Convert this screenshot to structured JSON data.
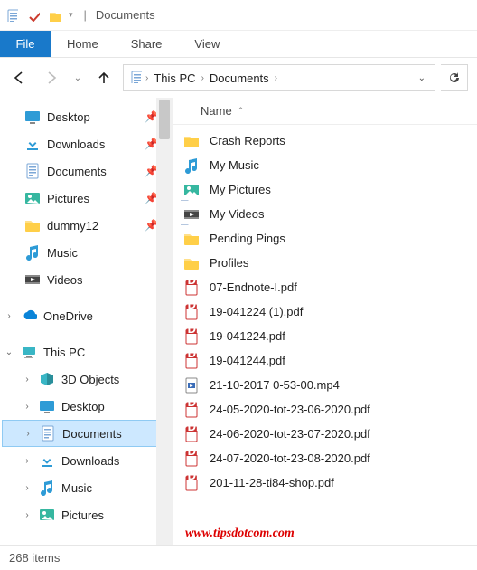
{
  "titlebar": {
    "window_title": "Documents"
  },
  "ribbon": {
    "file": "File",
    "tabs": [
      "Home",
      "Share",
      "View"
    ]
  },
  "breadcrumb": {
    "segments": [
      "This PC",
      "Documents"
    ]
  },
  "nav_tree": {
    "quick_access": [
      {
        "name": "Desktop",
        "icon": "desktop",
        "pinned": true
      },
      {
        "name": "Downloads",
        "icon": "downloads",
        "pinned": true
      },
      {
        "name": "Documents",
        "icon": "documents",
        "pinned": true
      },
      {
        "name": "Pictures",
        "icon": "pictures",
        "pinned": true
      },
      {
        "name": "dummy12",
        "icon": "folder",
        "pinned": true
      },
      {
        "name": "Music",
        "icon": "music",
        "pinned": false
      },
      {
        "name": "Videos",
        "icon": "videos",
        "pinned": false
      }
    ],
    "onedrive": {
      "name": "OneDrive"
    },
    "this_pc": {
      "name": "This PC",
      "children": [
        {
          "name": "3D Objects",
          "icon": "3d"
        },
        {
          "name": "Desktop",
          "icon": "desktop"
        },
        {
          "name": "Documents",
          "icon": "documents",
          "selected": true
        },
        {
          "name": "Downloads",
          "icon": "downloads"
        },
        {
          "name": "Music",
          "icon": "music"
        },
        {
          "name": "Pictures",
          "icon": "pictures"
        }
      ]
    }
  },
  "columns": {
    "name": "Name"
  },
  "files": [
    {
      "name": "Crash Reports",
      "icon": "folder"
    },
    {
      "name": "My Music",
      "icon": "shortcut-music"
    },
    {
      "name": "My Pictures",
      "icon": "shortcut-pictures"
    },
    {
      "name": "My Videos",
      "icon": "shortcut-videos"
    },
    {
      "name": "Pending Pings",
      "icon": "folder"
    },
    {
      "name": "Profiles",
      "icon": "folder"
    },
    {
      "name": "07-Endnote-I.pdf",
      "icon": "pdf"
    },
    {
      "name": "19-041224 (1).pdf",
      "icon": "pdf"
    },
    {
      "name": "19-041224.pdf",
      "icon": "pdf"
    },
    {
      "name": "19-041244.pdf",
      "icon": "pdf"
    },
    {
      "name": "21-10-2017 0-53-00.mp4",
      "icon": "video"
    },
    {
      "name": "24-05-2020-tot-23-06-2020.pdf",
      "icon": "pdf"
    },
    {
      "name": "24-06-2020-tot-23-07-2020.pdf",
      "icon": "pdf"
    },
    {
      "name": "24-07-2020-tot-23-08-2020.pdf",
      "icon": "pdf"
    },
    {
      "name": "201-11-28-ti84-shop.pdf",
      "icon": "pdf"
    }
  ],
  "status": {
    "item_count": "268 items"
  },
  "watermark": "www.tipsdotcom.com"
}
